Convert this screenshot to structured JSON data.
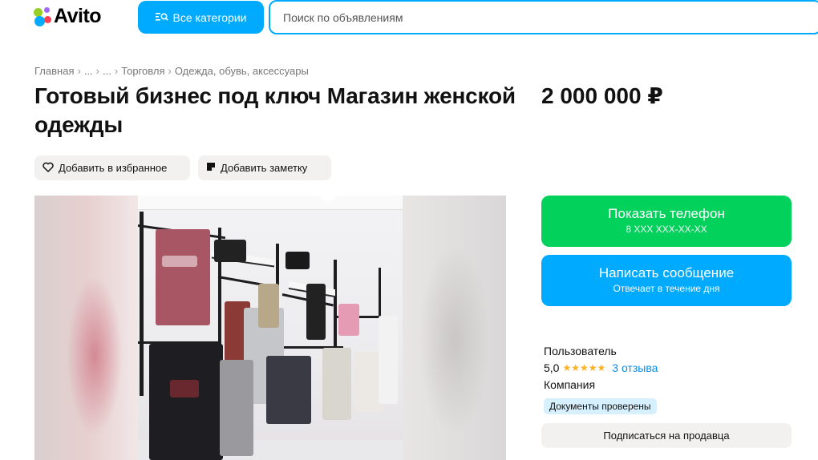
{
  "header": {
    "logo_text": "Avito",
    "categories_button": "Все категории",
    "search_placeholder": "Поиск по объявлениям"
  },
  "breadcrumb": [
    "Главная",
    "...",
    "...",
    "Торговля",
    "Одежда, обувь, аксессуары"
  ],
  "listing": {
    "title": "Готовый бизнес под ключ Магазин женской одежды",
    "price": "2 000 000 ₽",
    "add_favorite": "Добавить в избранное",
    "add_note": "Добавить заметку"
  },
  "contact": {
    "phone_button": "Показать телефон",
    "phone_mask": "8 XXX XXX-XX-XX",
    "message_button": "Написать сообщение",
    "message_note": "Отвечает в течение дня"
  },
  "seller": {
    "name": "Пользователь",
    "rating": "5,0",
    "stars": "★★★★★",
    "reviews": "3 отзыва",
    "type": "Компания",
    "badge": "Документы проверены",
    "subscribe": "Подписаться на продавца"
  },
  "colors": {
    "brand_blue": "#00aaff",
    "phone_green": "#02d15c",
    "star": "#ffb021",
    "link": "#0a8ee6"
  }
}
